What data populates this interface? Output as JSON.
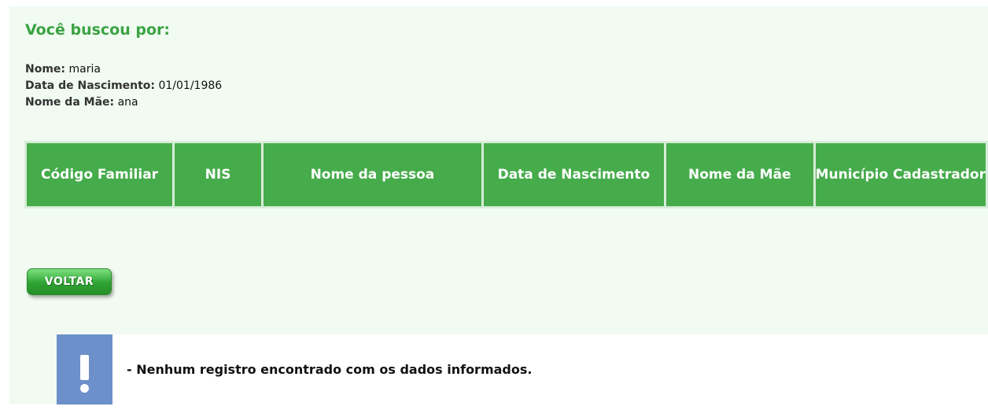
{
  "search_summary": {
    "title": "Você buscou por:",
    "criteria": [
      {
        "label": "Nome:",
        "value": "maria"
      },
      {
        "label": "Data de Nascimento:",
        "value": "01/01/1986"
      },
      {
        "label": "Nome da Mãe:",
        "value": "ana"
      }
    ]
  },
  "results_table": {
    "headers": [
      "Código Familiar",
      "NIS",
      "Nome da pessoa",
      "Data de Nascimento",
      "Nome da Mãe",
      "Município Cadastrador"
    ]
  },
  "actions": {
    "back_label": "VOLTAR"
  },
  "notice": {
    "icon": "exclamation-icon",
    "message": "- Nenhum registro encontrado com os dados informados."
  },
  "colors": {
    "panel_bg": "#f1fbf2",
    "title": "#3aa341",
    "header_bg": "#46ac4b",
    "notice_icon_bg": "#6d8fca"
  }
}
